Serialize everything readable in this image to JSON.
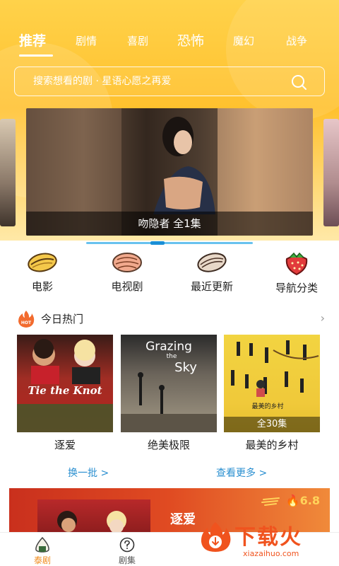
{
  "tabs": [
    {
      "label": "推荐",
      "active": true
    },
    {
      "label": "剧情"
    },
    {
      "label": "喜剧"
    },
    {
      "label": "恐怖"
    },
    {
      "label": "魔幻"
    },
    {
      "label": "战争"
    }
  ],
  "search": {
    "placeholder": "搜索想看的剧 · 星语心愿之再爱",
    "icon": "search-icon"
  },
  "banner": {
    "caption": "吻隐者 全1集",
    "slider_position": 0.42
  },
  "categories": [
    {
      "label": "电影",
      "icon": "sunflower-seed-icon"
    },
    {
      "label": "电视剧",
      "icon": "almond-icon"
    },
    {
      "label": "最近更新",
      "icon": "seed-icon"
    },
    {
      "label": "导航分类",
      "icon": "strawberry-icon"
    }
  ],
  "hot": {
    "title": "今日热门",
    "badge": "HOT",
    "arrow": "›",
    "items": [
      {
        "title": "逐爱",
        "poster_text": "Tie the Knot"
      },
      {
        "title": "绝美极限",
        "poster_text_1": "Grazing",
        "poster_text_2": "the",
        "poster_text_3": "Sky"
      },
      {
        "title": "最美的乡村",
        "badge": "全30集",
        "poster_text": "最美的乡村"
      }
    ]
  },
  "links": {
    "refresh": "换一批 >",
    "more": "查看更多 >"
  },
  "bottom_banner": {
    "title": "逐爱",
    "rating": "6.8"
  },
  "bottom_nav": [
    {
      "label": "泰剧",
      "icon": "onigiri-icon",
      "active": true
    },
    {
      "label": "剧集",
      "icon": "question-circle-icon"
    }
  ],
  "watermark": {
    "text": "下载火",
    "url": "xiazaihuo.com"
  },
  "colors": {
    "accent": "#f08c1e",
    "link": "#2a8fd0",
    "top_gradient": "#ffc12e"
  }
}
